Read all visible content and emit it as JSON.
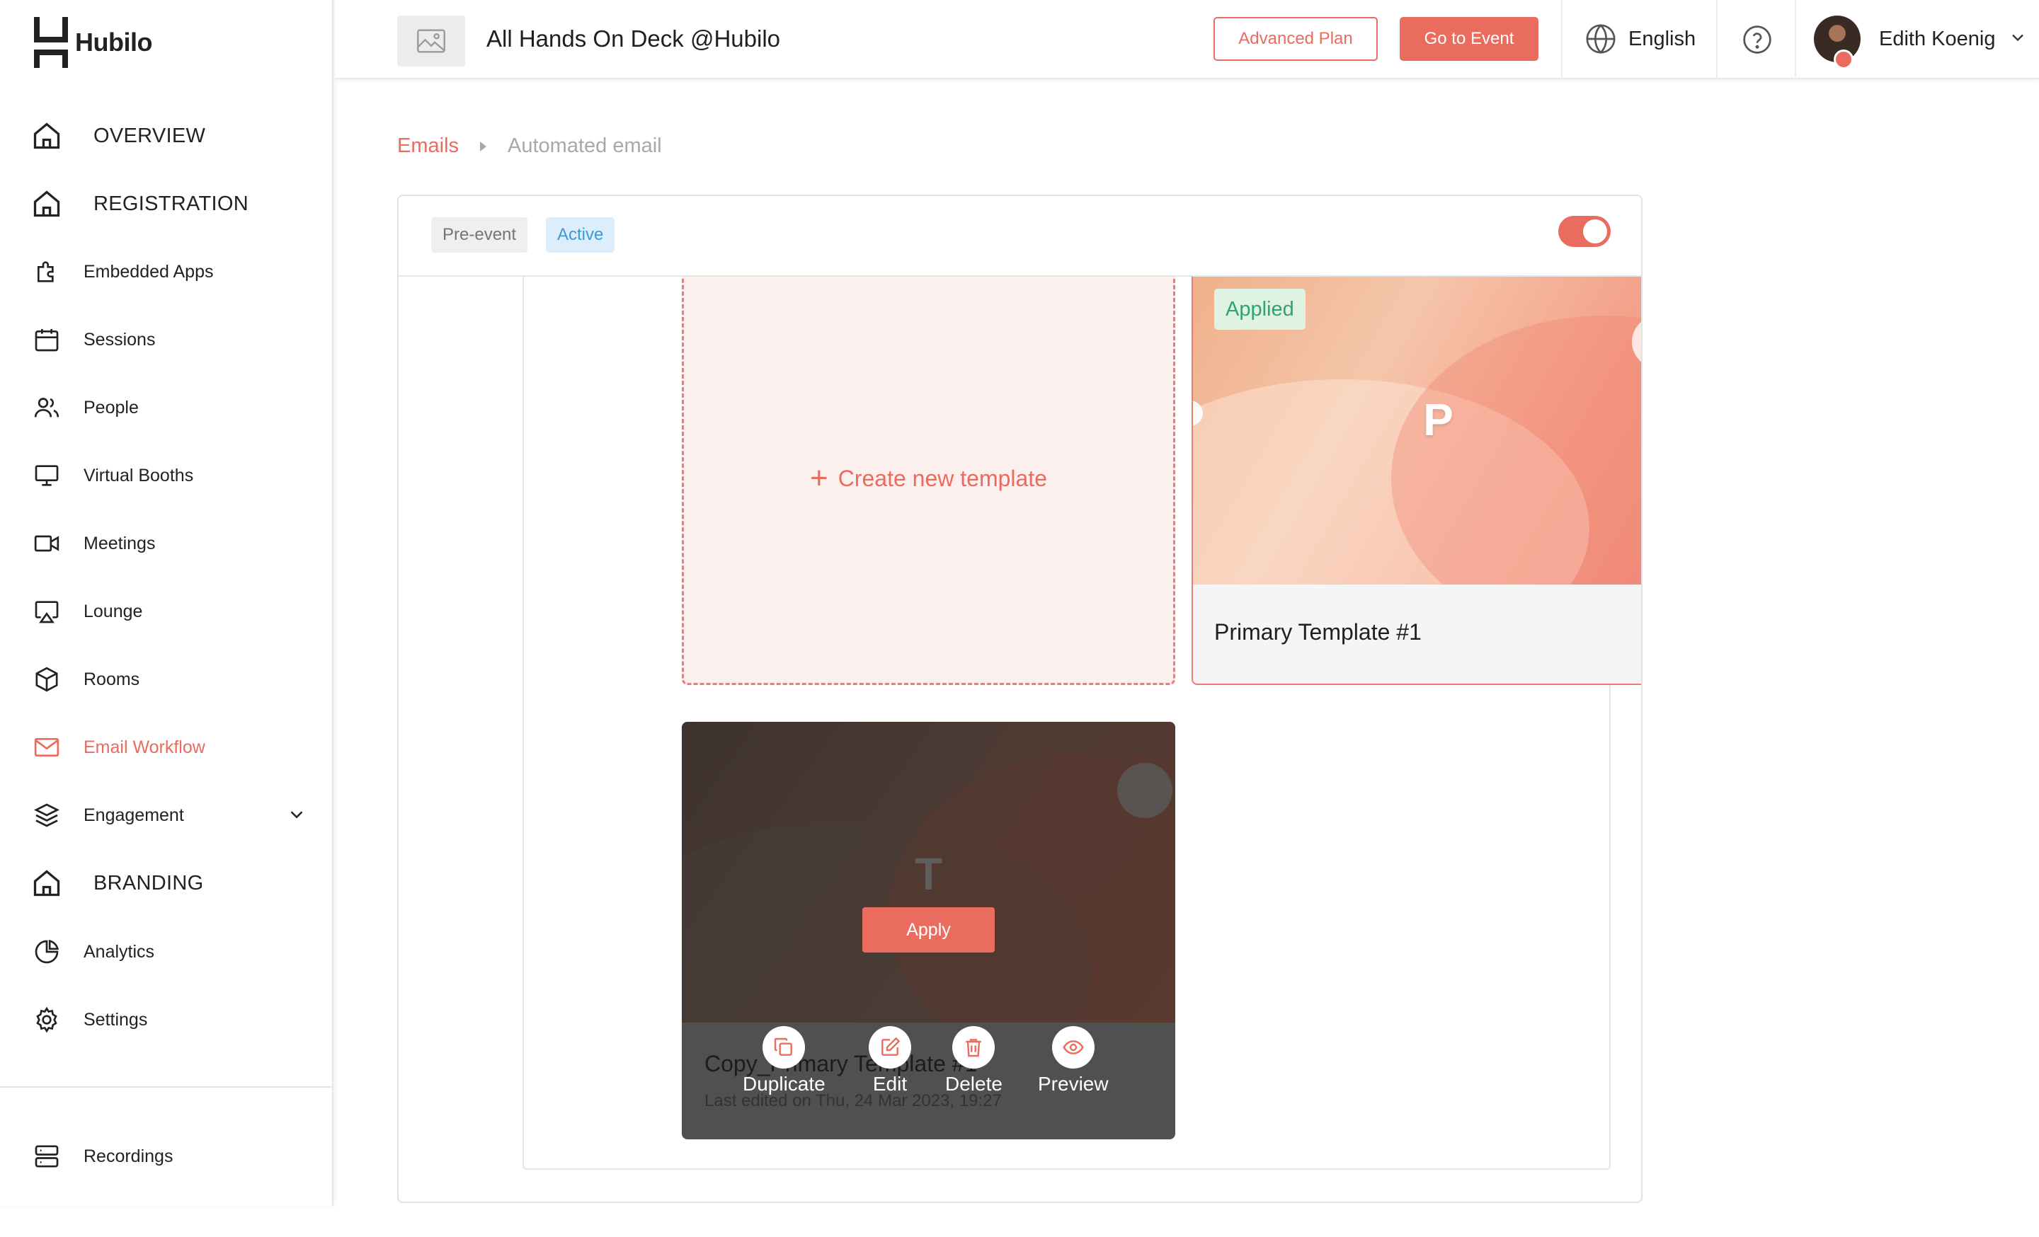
{
  "brand": {
    "name": "Hubilo",
    "accent": "#e96c5f"
  },
  "sidebar": {
    "items": [
      {
        "label": "OVERVIEW",
        "icon": "home-icon",
        "kind": "section"
      },
      {
        "label": "REGISTRATION",
        "icon": "home-icon",
        "kind": "section"
      },
      {
        "label": "Embedded Apps",
        "icon": "puzzle-icon"
      },
      {
        "label": "Sessions",
        "icon": "calendar-icon"
      },
      {
        "label": "People",
        "icon": "people-icon"
      },
      {
        "label": "Virtual Booths",
        "icon": "monitor-icon"
      },
      {
        "label": "Meetings",
        "icon": "video-icon"
      },
      {
        "label": "Lounge",
        "icon": "screen-share-icon"
      },
      {
        "label": "Rooms",
        "icon": "cube-icon"
      },
      {
        "label": "Email Workflow",
        "icon": "mail-icon",
        "active": true
      },
      {
        "label": "Engagement",
        "icon": "layers-icon",
        "expandable": true
      },
      {
        "label": "BRANDING",
        "icon": "home-icon",
        "kind": "section"
      },
      {
        "label": "Analytics",
        "icon": "pie-chart-icon"
      },
      {
        "label": "Settings",
        "icon": "gear-icon"
      }
    ],
    "footer": {
      "label": "Recordings",
      "icon": "server-icon"
    }
  },
  "header": {
    "event_title": "All Hands On Deck @Hubilo",
    "plan_button": "Advanced Plan",
    "go_button": "Go to Event",
    "language": "English",
    "user_name": "Edith Koenig"
  },
  "breadcrumb": {
    "root": "Emails",
    "current": "Automated email"
  },
  "card": {
    "tags": [
      "Pre-event",
      "Active"
    ],
    "toggle_on": true,
    "create_label": "Create new template",
    "templates": [
      {
        "letter": "P",
        "name": "Primary Template #1",
        "badge": "Applied"
      },
      {
        "letter": "T",
        "name": "Copy_Primary Template #1",
        "edited": "Last edited on Thu, 24 Mar 2023, 19:27",
        "apply_label": "Apply"
      }
    ],
    "actions": [
      "Duplicate",
      "Edit",
      "Delete",
      "Preview"
    ]
  }
}
